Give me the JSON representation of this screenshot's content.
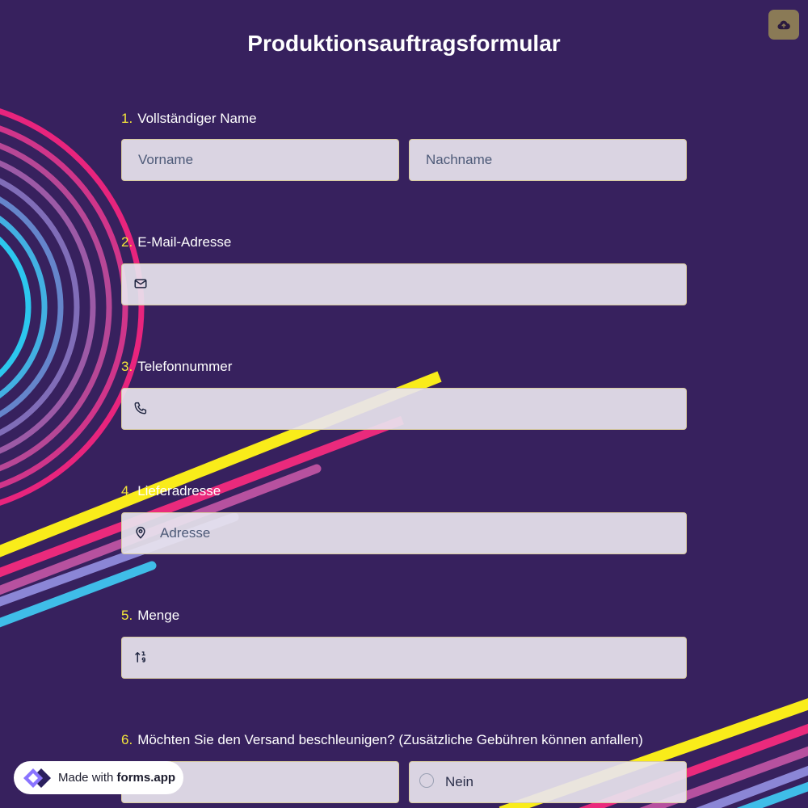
{
  "form": {
    "title": "Produktionsauftragsformular"
  },
  "questions": [
    {
      "number": "1.",
      "label": "Vollständiger Name",
      "fields": [
        {
          "placeholder": "Vorname"
        },
        {
          "placeholder": "Nachname"
        }
      ]
    },
    {
      "number": "2.",
      "label": "E-Mail-Adresse",
      "icon": "mail-icon"
    },
    {
      "number": "3.",
      "label": "Telefonnummer",
      "icon": "phone-icon"
    },
    {
      "number": "4.",
      "label": "Lieferadresse",
      "icon": "map-pin-icon",
      "placeholder": "Adresse"
    },
    {
      "number": "5.",
      "label": "Menge",
      "icon": "sort-numbers-icon"
    },
    {
      "number": "6.",
      "label": "Möchten Sie den Versand beschleunigen? (Zusätzliche Gebühren können anfallen)",
      "options": [
        "",
        "Nein"
      ]
    }
  ],
  "badge": {
    "prefix": "Made with",
    "brand": "forms.app"
  },
  "toolbar": {
    "upload_icon": "cloud-upload-icon"
  },
  "colors": {
    "background": "#37215e",
    "accent_number": "#f5e63a",
    "field_bg": "#e8e4ee",
    "field_border": "#d8cba0",
    "upload_button": "#8a7a56"
  }
}
